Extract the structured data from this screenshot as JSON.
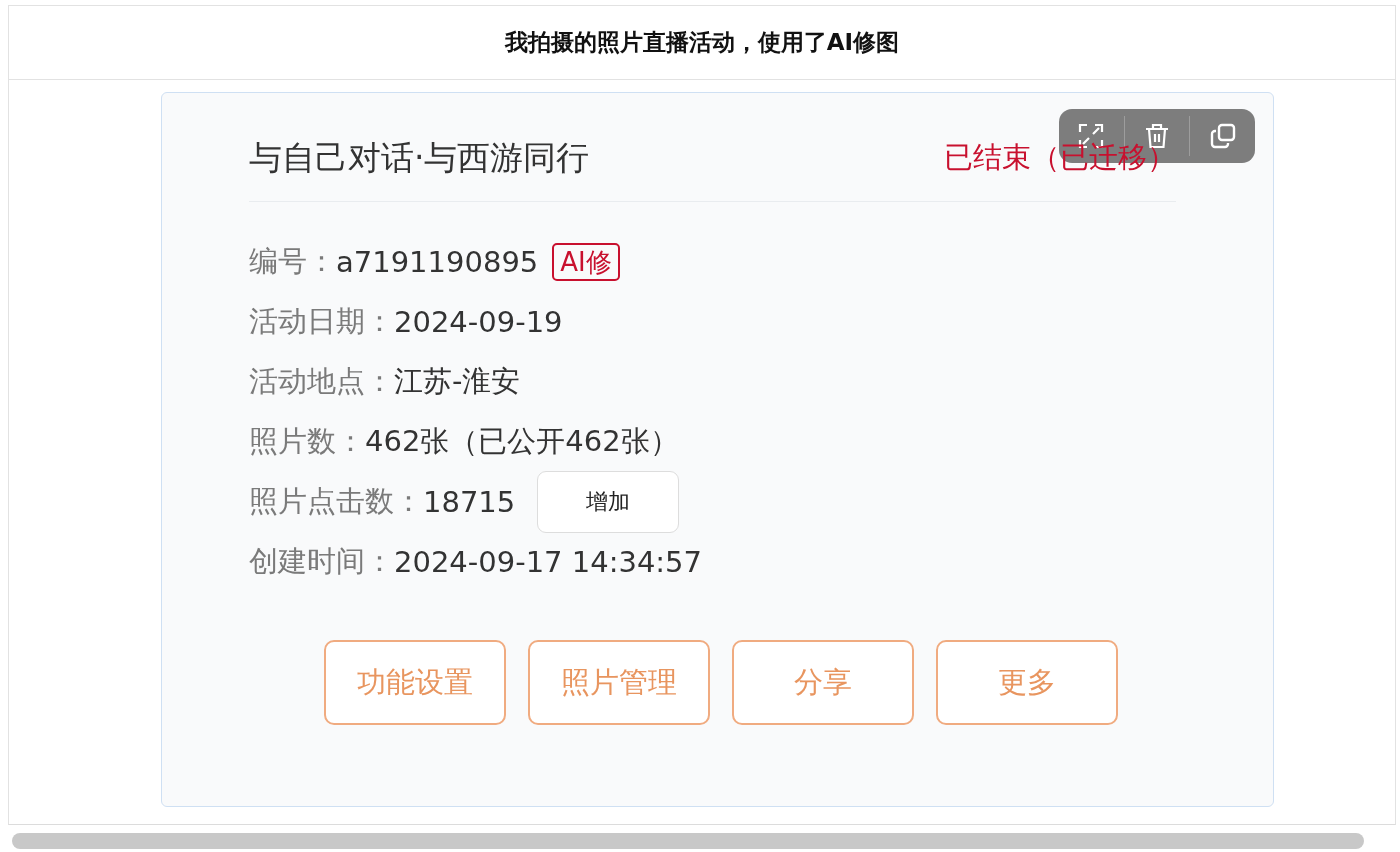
{
  "header": {
    "title": "我拍摄的照片直播活动，使用了AI修图"
  },
  "activity": {
    "title": "与自己对话·与西游同行",
    "status": "已结束（已迁移）",
    "fields": [
      {
        "kind": "badge",
        "label": "编号：",
        "value": "a7191190895",
        "badge": "AI修"
      },
      {
        "kind": "plain",
        "label": "活动日期：",
        "value": "2024-09-19"
      },
      {
        "kind": "plain",
        "label": "活动地点：",
        "value": "江苏-淮安"
      },
      {
        "kind": "plain",
        "label": "照片数：",
        "value": "462张（已公开462张）"
      },
      {
        "kind": "button",
        "label": "照片点击数：",
        "value": "18715",
        "button": "增加"
      },
      {
        "kind": "plain",
        "label": "创建时间：",
        "value": "2024-09-17 14:34:57"
      }
    ],
    "actions": [
      "功能设置",
      "照片管理",
      "分享",
      "更多"
    ]
  }
}
